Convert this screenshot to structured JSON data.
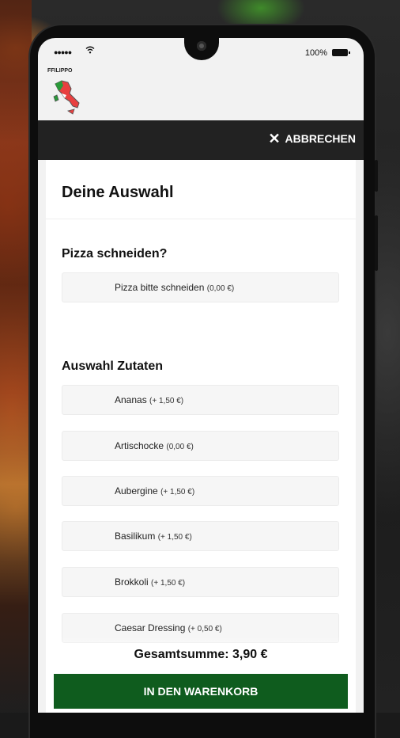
{
  "status_bar": {
    "battery_percent": "100%"
  },
  "brand": {
    "name": "FFILIPPO"
  },
  "header": {
    "cancel_label": "ABBRECHEN"
  },
  "sheet": {
    "title": "Deine Auswahl",
    "sections": [
      {
        "title": "Pizza schneiden?",
        "options": [
          {
            "label": "Pizza bitte schneiden",
            "price": "(0,00 €)"
          }
        ]
      },
      {
        "title": "Auswahl Zutaten",
        "options": [
          {
            "label": "Ananas",
            "price": "(+ 1,50 €)"
          },
          {
            "label": "Artischocke",
            "price": "(0,00 €)"
          },
          {
            "label": "Aubergine",
            "price": "(+ 1,50 €)"
          },
          {
            "label": "Basilikum",
            "price": "(+ 1,50 €)"
          },
          {
            "label": "Brokkoli",
            "price": "(+ 1,50 €)"
          },
          {
            "label": "Caesar Dressing",
            "price": "(+ 0,50 €)"
          }
        ]
      }
    ]
  },
  "footer": {
    "total": "Gesamtsumme: 3,90 €",
    "add_to_cart_label": "IN DEN WARENKORB"
  },
  "colors": {
    "header_bg": "#222222",
    "cart_button": "#0f5c1e",
    "sheet_bg": "#ffffff"
  },
  "icons": [
    "close-icon",
    "signal-icon",
    "wifi-icon",
    "battery-icon",
    "italy-map-logo"
  ]
}
